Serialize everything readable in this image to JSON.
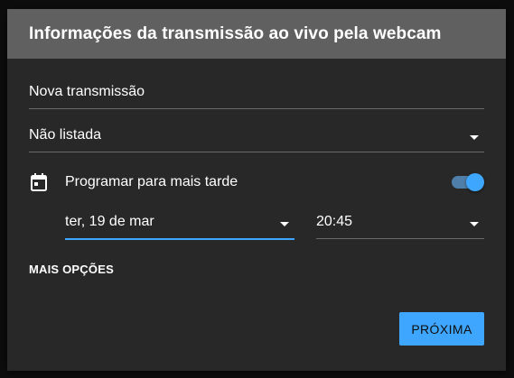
{
  "dialog": {
    "title": "Informações da transmissão ao vivo pela webcam"
  },
  "form": {
    "title_value": "Nova transmissão",
    "privacy_value": "Não listada",
    "schedule": {
      "label": "Programar para mais tarde",
      "enabled": true,
      "icon": "calendar-icon"
    },
    "date_value": "ter, 19 de mar",
    "time_value": "20:45",
    "more_options_label": "MAIS OPÇÕES"
  },
  "actions": {
    "next_label": "PRÓXIMA"
  },
  "colors": {
    "accent": "#3ea6ff",
    "header_bg": "#606060",
    "dialog_bg": "#282828"
  }
}
